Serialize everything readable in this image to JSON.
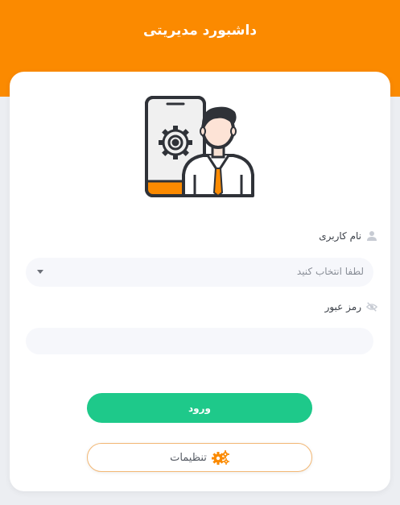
{
  "header": {
    "title": "داشبورد مدیریتی",
    "color": "#fb8a00"
  },
  "hero": {
    "icon": "admin-phone-gear-icon"
  },
  "form": {
    "username_label": "نام کاربری",
    "username_icon": "user-icon",
    "username_placeholder": "لطفا انتخاب کنید",
    "password_label": "رمز عبور",
    "password_icon": "eye-slash-icon",
    "password_value": ""
  },
  "actions": {
    "login_label": "ورود",
    "login_color": "#1ec98a",
    "settings_label": "تنظیمات",
    "settings_icon": "gears-icon",
    "settings_icon_color": "#fb8a00"
  }
}
